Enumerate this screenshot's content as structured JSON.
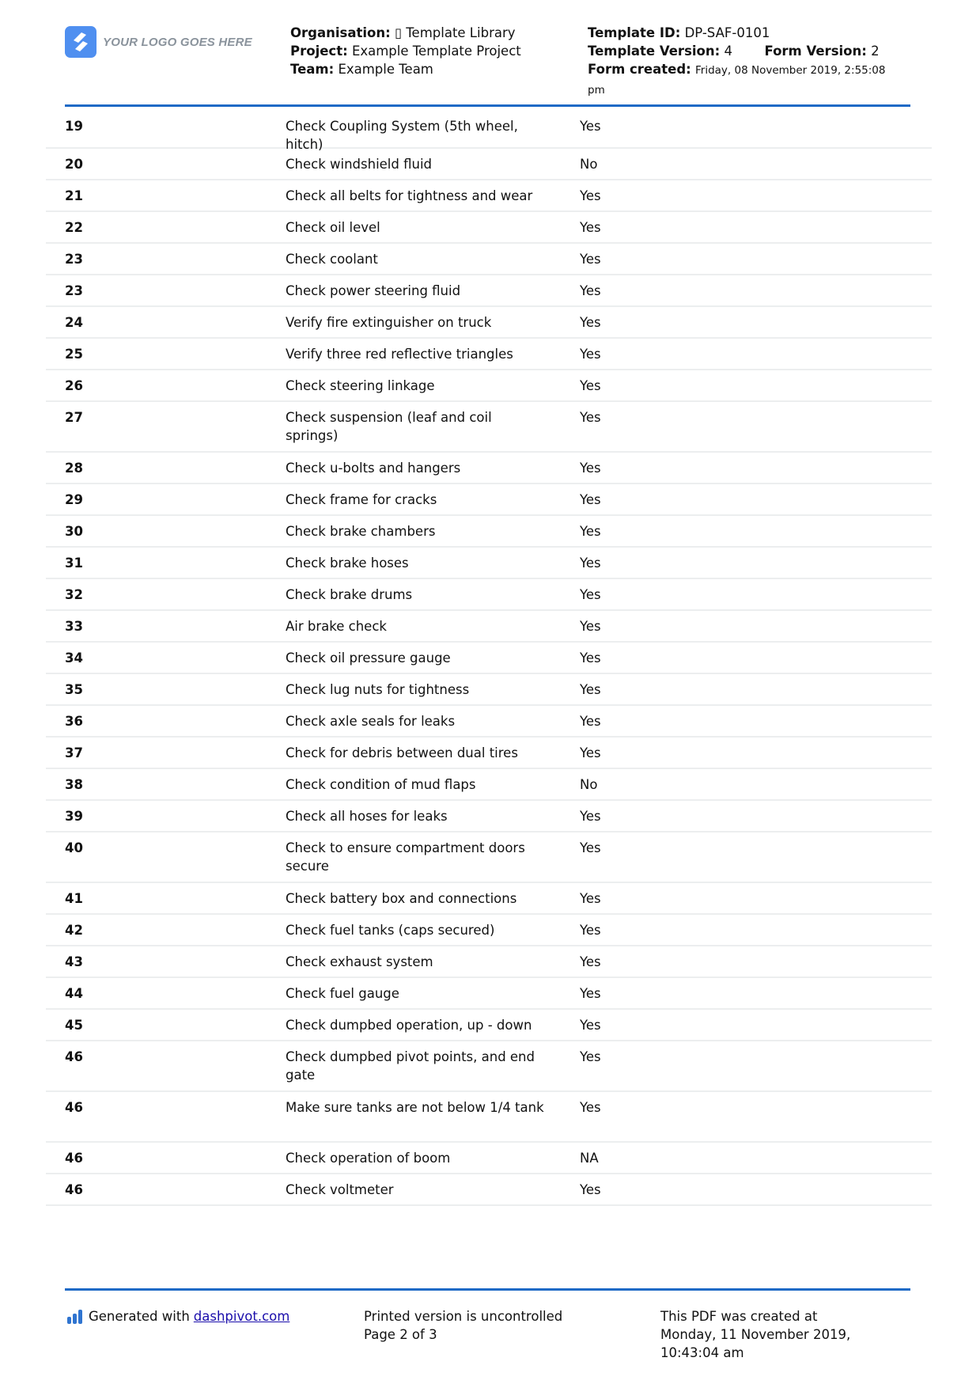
{
  "header": {
    "logo_text": "YOUR LOGO GOES HERE",
    "organisation_label": "Organisation:",
    "organisation_value": "▯ Template Library",
    "project_label": "Project:",
    "project_value": "Example Template Project",
    "team_label": "Team:",
    "team_value": "Example Team",
    "template_id_label": "Template ID:",
    "template_id_value": "DP-SAF-0101",
    "template_version_label": "Template Version:",
    "template_version_value": "4",
    "form_version_label": "Form Version:",
    "form_version_value": "2",
    "form_created_label": "Form created:",
    "form_created_value": "Friday, 08 November 2019, 2:55:08 pm"
  },
  "rows": [
    {
      "num": "19",
      "item": "Check Coupling System (5th wheel, hitch)",
      "value": "Yes"
    },
    {
      "num": "20",
      "item": "Check windshield fluid",
      "value": "No"
    },
    {
      "num": "21",
      "item": "Check all belts for tightness and wear",
      "value": "Yes"
    },
    {
      "num": "22",
      "item": "Check oil level",
      "value": "Yes"
    },
    {
      "num": "23",
      "item": "Check coolant",
      "value": "Yes"
    },
    {
      "num": "23",
      "item": "Check power steering fluid",
      "value": "Yes"
    },
    {
      "num": "24",
      "item": "Verify fire extinguisher on truck",
      "value": "Yes"
    },
    {
      "num": "25",
      "item": "Verify three red reflective triangles",
      "value": "Yes"
    },
    {
      "num": "26",
      "item": "Check steering linkage",
      "value": "Yes"
    },
    {
      "num": "27",
      "item": "Check suspension (leaf and coil springs)",
      "value": "Yes"
    },
    {
      "num": "28",
      "item": "Check u-bolts and hangers",
      "value": "Yes"
    },
    {
      "num": "29",
      "item": "Check frame for cracks",
      "value": "Yes"
    },
    {
      "num": "30",
      "item": "Check brake chambers",
      "value": "Yes"
    },
    {
      "num": "31",
      "item": "Check brake hoses",
      "value": "Yes"
    },
    {
      "num": "32",
      "item": "Check brake drums",
      "value": "Yes"
    },
    {
      "num": "33",
      "item": "Air brake check",
      "value": "Yes"
    },
    {
      "num": "34",
      "item": "Check oil pressure gauge",
      "value": "Yes"
    },
    {
      "num": "35",
      "item": "Check lug nuts for tightness",
      "value": "Yes"
    },
    {
      "num": "36",
      "item": "Check axle seals for leaks",
      "value": "Yes"
    },
    {
      "num": "37",
      "item": "Check for debris between dual tires",
      "value": "Yes"
    },
    {
      "num": "38",
      "item": "Check condition of mud flaps",
      "value": "No"
    },
    {
      "num": "39",
      "item": "Check all hoses for leaks",
      "value": "Yes"
    },
    {
      "num": "40",
      "item": "Check to ensure compartment doors secure",
      "value": "Yes"
    },
    {
      "num": "41",
      "item": "Check battery box and connections",
      "value": "Yes"
    },
    {
      "num": "42",
      "item": "Check fuel tanks (caps secured)",
      "value": "Yes"
    },
    {
      "num": "43",
      "item": "Check exhaust system",
      "value": "Yes"
    },
    {
      "num": "44",
      "item": "Check fuel gauge",
      "value": "Yes"
    },
    {
      "num": "45",
      "item": "Check dumpbed operation, up - down",
      "value": "Yes"
    },
    {
      "num": "46",
      "item": "Check dumpbed pivot points, and end gate",
      "value": "Yes"
    },
    {
      "num": "46",
      "item": "Make sure tanks are not below 1/4 tank",
      "value": "Yes"
    },
    {
      "num": "46",
      "item": "Check operation of boom",
      "value": "NA"
    },
    {
      "num": "46",
      "item": "Check voltmeter",
      "value": "Yes"
    }
  ],
  "footer": {
    "generated_prefix": "Generated with",
    "generated_link": "dashpivot.com",
    "uncontrolled": "Printed version is uncontrolled",
    "page": "Page 2 of 3",
    "created_line1": "This PDF was created at",
    "created_line2": "Monday, 11 November 2019,",
    "created_line3": "10:43:04 am"
  }
}
